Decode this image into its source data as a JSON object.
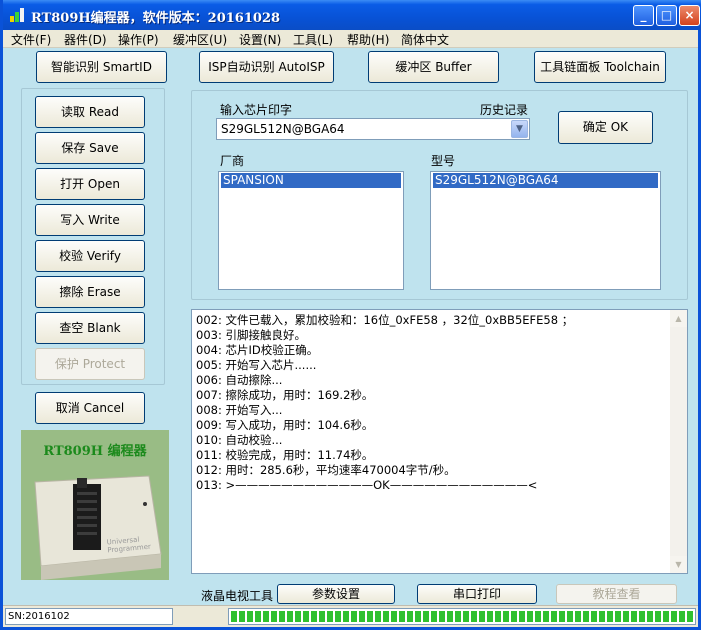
{
  "window": {
    "title": "RT809H编程器，软件版本：20161028",
    "controls": [
      "_",
      "□",
      "×"
    ]
  },
  "menu": [
    {
      "label": "文件(F)"
    },
    {
      "label": "器件(D)"
    },
    {
      "label": "操作(P)"
    },
    {
      "label": "缓冲区(U)"
    },
    {
      "label": "设置(N)"
    },
    {
      "label": "工具(L)"
    },
    {
      "label": "帮助(H)"
    },
    {
      "label": "简体中文"
    }
  ],
  "top_buttons": {
    "smartid": "智能识别 SmartID",
    "autoisp": "ISP自动识别 AutoISP",
    "buffer": "缓冲区 Buffer",
    "toolchain": "工具链面板 Toolchain"
  },
  "side_buttons": {
    "read": "读取 Read",
    "save": "保存 Save",
    "open": "打开 Open",
    "write": "写入 Write",
    "verify": "校验 Verify",
    "erase": "擦除 Erase",
    "blank": "查空 Blank",
    "protect": "保护 Protect",
    "cancel": "取消 Cancel"
  },
  "chip": {
    "input_label": "输入芯片印字",
    "history_label": "历史记录",
    "value": "S29GL512N@BGA64",
    "ok_button": "确定 OK",
    "vendor_label": "厂商",
    "model_label": "型号",
    "vendor_selected": "SPANSION",
    "model_selected": "S29GL512N@BGA64"
  },
  "log": [
    "002: 文件已载入，累加校验和：16位_0xFE58 ，32位_0xBB5EFE58 ；",
    "003: 引脚接触良好。",
    "004: 芯片ID校验正确。",
    "005: 开始写入芯片......",
    "006: 自动擦除...",
    "007: 擦除成功，用时：169.2秒。",
    "008: 开始写入...",
    "009: 写入成功，用时：104.6秒。",
    "010: 自动校验...",
    "011: 校验完成，用时：11.74秒。",
    "012: 用时：285.6秒，平均速率470004字节/秒。",
    "013: >————————————OK————————————<"
  ],
  "bottom": {
    "lcd_label": "液晶电视工具",
    "params_button": "参数设置",
    "serial_button": "串口打印",
    "tutorial_button": "教程查看"
  },
  "product": {
    "brand_text": "RT809H 编程器",
    "device_text": "Universal Programmer"
  },
  "status": {
    "sn": "SN:2016102",
    "progress": 1.0,
    "progress_color": "#2fc02f"
  },
  "colors": {
    "window_bg": "#bfe3ee",
    "title_blue": "#0a5ce6",
    "selection": "#316ac5"
  }
}
